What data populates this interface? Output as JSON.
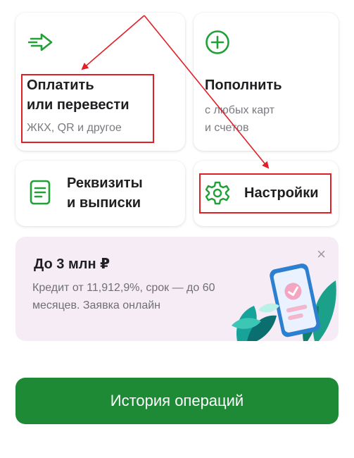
{
  "pay": {
    "title_line1": "Оплатить",
    "title_line2": "или перевести",
    "subtitle": "ЖКХ, QR и другое"
  },
  "topup": {
    "title": "Пополнить",
    "subtitle_line1": "с любых карт",
    "subtitle_line2": "и счетов"
  },
  "requisites": {
    "title_line1": "Реквизиты",
    "title_line2": "и выписки"
  },
  "settings": {
    "title": "Настройки"
  },
  "promo": {
    "title": "До 3 млн ₽",
    "text": "Кредит от 11,912,9%, срок — до 60 месяцев. Заявка онлайн",
    "close": "×"
  },
  "history_button": {
    "label": "История операций"
  },
  "colors": {
    "brand_green": "#1e8a36",
    "icon_green": "#21a038",
    "annotation_red": "#e01f26",
    "promo_bg": "#f6ecf6"
  },
  "icons": {
    "pay": "transfer-arrow-icon",
    "topup": "plus-circle-icon",
    "requisites": "document-icon",
    "settings": "gear-icon",
    "promo_close": "close-icon"
  }
}
